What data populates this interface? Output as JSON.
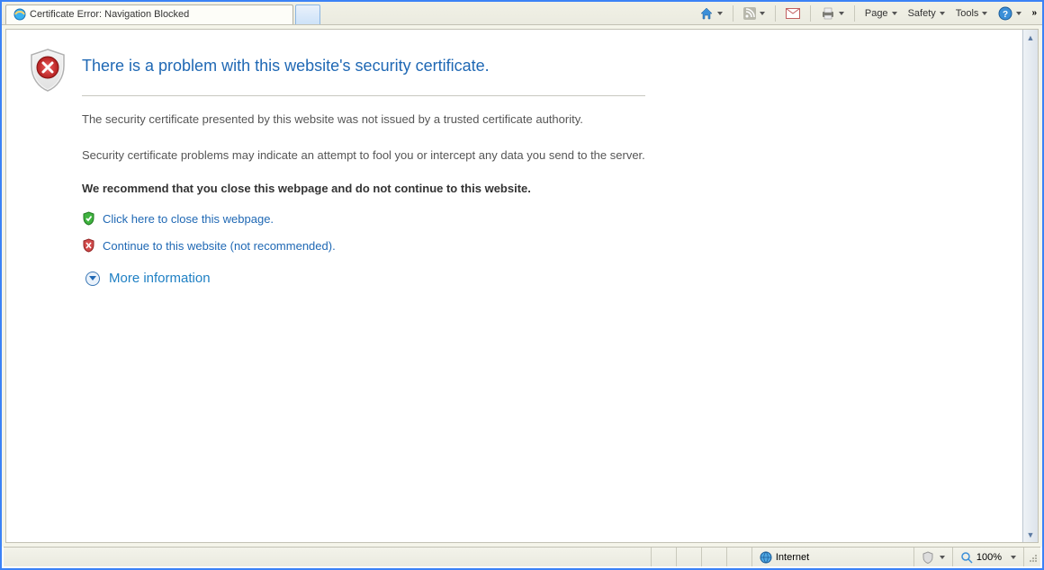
{
  "tab": {
    "title": "Certificate Error: Navigation Blocked"
  },
  "toolbar": {
    "page_label": "Page",
    "safety_label": "Safety",
    "tools_label": "Tools"
  },
  "warning": {
    "title": "There is a problem with this website's security certificate.",
    "line1": "The security certificate presented by this website was not issued by a trusted certificate authority.",
    "line2": "Security certificate problems may indicate an attempt to fool you or intercept any data you send to the server.",
    "recommend": "We recommend that you close this webpage and do not continue to this website.",
    "close_link": "Click here to close this webpage.",
    "continue_link": "Continue to this website (not recommended).",
    "more_info": "More information"
  },
  "status": {
    "zone": "Internet",
    "zoom": "100%"
  }
}
